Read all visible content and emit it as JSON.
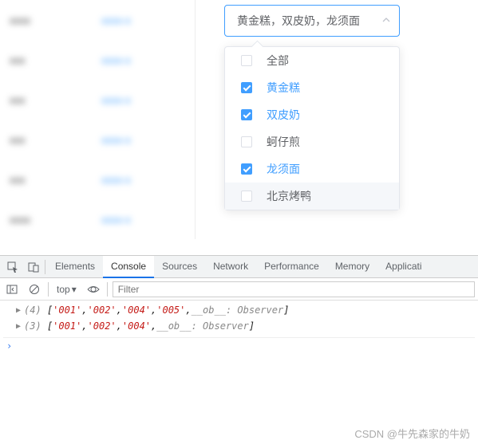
{
  "select": {
    "value": "黄金糕，双皮奶，龙须面",
    "options": [
      {
        "label": "全部",
        "checked": false,
        "hover": false
      },
      {
        "label": "黄金糕",
        "checked": true,
        "hover": false
      },
      {
        "label": "双皮奶",
        "checked": true,
        "hover": false
      },
      {
        "label": "蚵仔煎",
        "checked": false,
        "hover": false
      },
      {
        "label": "龙须面",
        "checked": true,
        "hover": false
      },
      {
        "label": "北京烤鸭",
        "checked": false,
        "hover": true
      }
    ]
  },
  "table": {
    "left": [
      "xxxx",
      "xxx",
      "xxx",
      "xxx",
      "xxx",
      "xxxx"
    ],
    "mid": [
      "xxxx-x",
      "xxxx-x",
      "xxxx-x",
      "xxxx-x",
      "xxxx-x",
      "xxxx-x"
    ]
  },
  "devtools": {
    "tabs": [
      "Elements",
      "Console",
      "Sources",
      "Network",
      "Performance",
      "Memory",
      "Applicati"
    ],
    "active_tab": "Console",
    "context": "top",
    "filter_placeholder": "Filter",
    "lines": [
      {
        "count": 4,
        "items": [
          "'001'",
          "'002'",
          "'004'",
          "'005'"
        ],
        "suffix": "__ob__: Observer"
      },
      {
        "count": 3,
        "items": [
          "'001'",
          "'002'",
          "'004'"
        ],
        "suffix": "__ob__: Observer"
      }
    ]
  },
  "watermark": "CSDN @牛先森家的牛奶"
}
